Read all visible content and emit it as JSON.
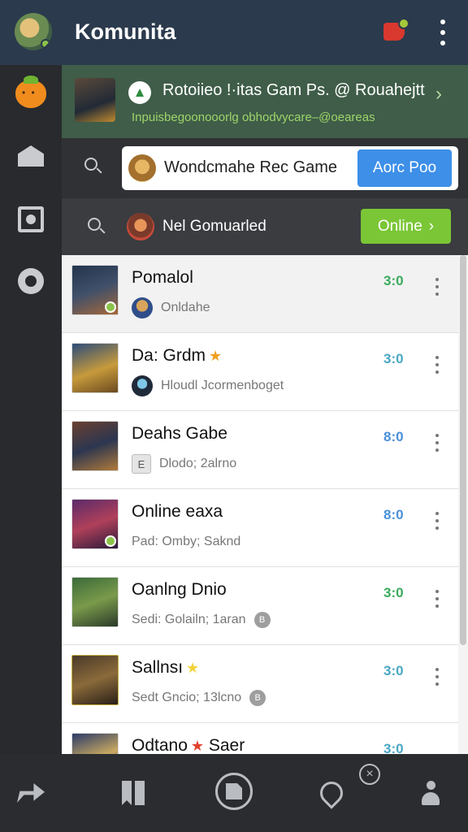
{
  "header": {
    "title": "Komunita",
    "avatar_icon": "user-avatar",
    "notification_icon": "notification-icon",
    "menu_icon": "more-vertical-icon"
  },
  "sidebar": {
    "items": [
      {
        "name": "brand-logo",
        "icon": "fruit-logo-icon"
      },
      {
        "name": "home",
        "icon": "home-icon"
      },
      {
        "name": "grid",
        "icon": "grid-icon"
      },
      {
        "name": "circle",
        "icon": "circle-icon"
      }
    ]
  },
  "promo": {
    "title": "Rotoiieo !·itas Gam Ps. @ Rouahejtt",
    "subtitle": "Inpuisbegoonooorlg obhodvycare–@oeareas",
    "badge_icon": "triangle-logo-icon"
  },
  "search": {
    "value": "Wondcmahe Rec Game",
    "button_label": "Aorc Poo"
  },
  "filter": {
    "label": "Nel Gomuarled",
    "online_label": "Online"
  },
  "list": {
    "rows": [
      {
        "name": "Pomalol",
        "sub": "Onldahe",
        "score": "3:0",
        "score_color": "#3aab5e",
        "star": false
      },
      {
        "name": "Da: Grdm",
        "sub": "Hloudl Jcormenboget",
        "score": "3:0",
        "score_color": "#4aa8c5",
        "star": true
      },
      {
        "name": "Deahs Gabe",
        "sub": "Dlodo; 2alrno",
        "score": "8:0",
        "score_color": "#4a90d9",
        "star": false
      },
      {
        "name": "Online eaxa",
        "sub": "Pad: Omby; Saknd",
        "score": "8:0",
        "score_color": "#4a90d9",
        "star": false
      },
      {
        "name": "Oanlng Dnio",
        "sub": "Sedi: Golailn; 1aran",
        "score": "3:0",
        "score_color": "#3aab5e",
        "star": false
      },
      {
        "name": "Sallnsı",
        "sub": "Sedt Gncio; 13lcno",
        "score": "3:0",
        "score_color": "#4aa8c5",
        "star": true
      },
      {
        "name": "Odtano",
        "name_suffix": "Saer",
        "score": "3:0",
        "score_color": "#4aa8c5"
      }
    ]
  },
  "colors": {
    "header_bg": "#2b3a4d",
    "promo_bg": "#3f5d48",
    "search_button": "#3d8fe8",
    "online_button": "#7bc636"
  }
}
